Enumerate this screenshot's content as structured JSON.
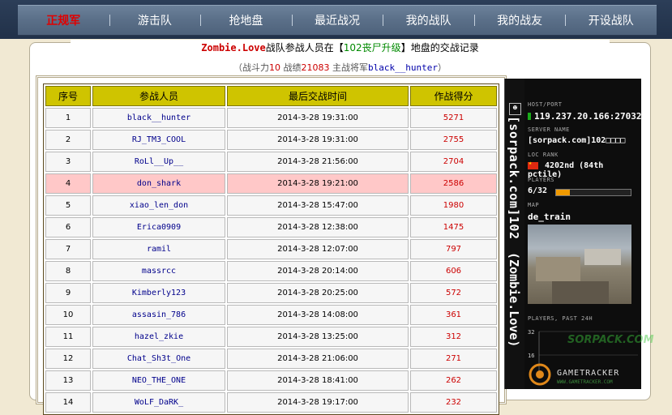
{
  "nav": {
    "items": [
      {
        "label": "正规军",
        "active": true
      },
      {
        "label": "游击队",
        "active": false
      },
      {
        "label": "抢地盘",
        "active": false
      },
      {
        "label": "最近战况",
        "active": false
      },
      {
        "label": "我的战队",
        "active": false
      },
      {
        "label": "我的战友",
        "active": false
      },
      {
        "label": "开设战队",
        "active": false
      }
    ]
  },
  "heading": {
    "team": "Zombie.Love",
    "text1": "战队参战人员在【",
    "server": "102丧尸升级",
    "text2": "】地盘的交战记录"
  },
  "subheading": {
    "prefix": "（战斗力",
    "power": "10",
    "mid": " 战绩",
    "record": "21083",
    "general_label": " 主战将军",
    "general": "black__hunter",
    "suffix": "）"
  },
  "table": {
    "columns": [
      "序号",
      "参战人员",
      "最后交战时间",
      "作战得分"
    ],
    "rows": [
      {
        "no": "1",
        "name": "black__hunter",
        "time": "2014-3-28 19:31:00",
        "score": "5271",
        "highlight": false
      },
      {
        "no": "2",
        "name": "RJ_TM3_COOL",
        "time": "2014-3-28 19:31:00",
        "score": "2755",
        "highlight": false
      },
      {
        "no": "3",
        "name": "RoLl__Up__",
        "time": "2014-3-28 21:56:00",
        "score": "2704",
        "highlight": false
      },
      {
        "no": "4",
        "name": "don_shark",
        "time": "2014-3-28 19:21:00",
        "score": "2586",
        "highlight": true
      },
      {
        "no": "5",
        "name": "xiao_len_don",
        "time": "2014-3-28 15:47:00",
        "score": "1980",
        "highlight": false
      },
      {
        "no": "6",
        "name": "Erica0909",
        "time": "2014-3-28 12:38:00",
        "score": "1475",
        "highlight": false
      },
      {
        "no": "7",
        "name": "ramil",
        "time": "2014-3-28 12:07:00",
        "score": "797",
        "highlight": false
      },
      {
        "no": "8",
        "name": "massrcc",
        "time": "2014-3-28 20:14:00",
        "score": "606",
        "highlight": false
      },
      {
        "no": "9",
        "name": "Kimberly123",
        "time": "2014-3-28 20:25:00",
        "score": "572",
        "highlight": false
      },
      {
        "no": "10",
        "name": "assasin_786",
        "time": "2014-3-28 14:08:00",
        "score": "361",
        "highlight": false
      },
      {
        "no": "11",
        "name": "hazel_zkie",
        "time": "2014-3-28 13:25:00",
        "score": "312",
        "highlight": false
      },
      {
        "no": "12",
        "name": "Chat_Sh3t_One",
        "time": "2014-3-28 21:06:00",
        "score": "271",
        "highlight": false
      },
      {
        "no": "13",
        "name": "NEO_THE_ONE",
        "time": "2014-3-28 18:41:00",
        "score": "262",
        "highlight": false
      },
      {
        "no": "14",
        "name": "WoLF_DaRK_",
        "time": "2014-3-28 19:17:00",
        "score": "232",
        "highlight": false
      }
    ]
  },
  "tracker": {
    "vertical_name": "[sorpack.com]102",
    "vertical_team": "(Zombie.Love)",
    "host_label": "HOST/PORT",
    "host": "119.237.20.166:27032",
    "server_label": "SERVER NAME",
    "server_name": "[sorpack.com]102□□□□",
    "rank_label": "LOC  RANK",
    "rank": "4202nd (84th pctile)",
    "players_label": "PLAYERS",
    "players": "6/32",
    "players_fraction": 0.1875,
    "map_label": "MAP",
    "map": "de_train",
    "past_label": "PLAYERS, PAST 24H",
    "chart_max": "32",
    "chart_mid": "16",
    "logo": "GAMETRACKER",
    "logo_url": "WWW.GAMETRACKER.COM",
    "watermark": "SORPACK.COM",
    "colors": {
      "orange": "#f09a00",
      "green": "#1aaa1a"
    }
  }
}
